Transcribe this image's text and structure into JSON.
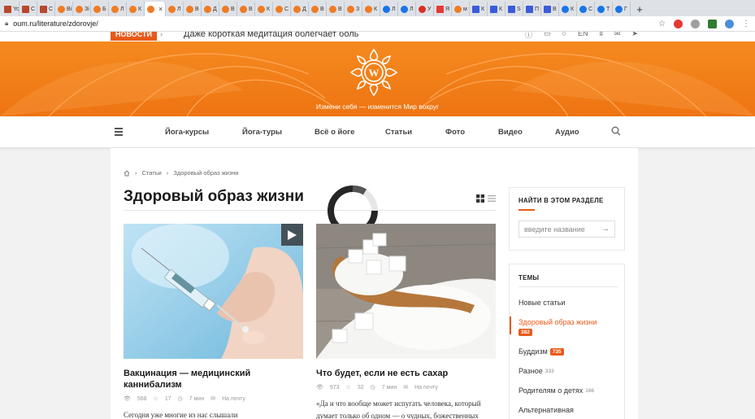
{
  "browser": {
    "tabs": [
      {
        "label": "Yo",
        "color": "#b8472b",
        "sq": true
      },
      {
        "label": "C",
        "color": "#b8472b",
        "sq": true
      },
      {
        "label": "C",
        "color": "#b8472b",
        "sq": true
      },
      {
        "label": "Bi",
        "color": "#f07b23"
      },
      {
        "label": "Зі",
        "color": "#f07b23"
      },
      {
        "label": "Б",
        "color": "#f07b23"
      },
      {
        "label": "Л",
        "color": "#f07b23"
      },
      {
        "label": "К",
        "color": "#f07b23"
      },
      {
        "label": "",
        "color": "#f07b23",
        "active": true
      },
      {
        "label": "Л",
        "color": "#f07b23"
      },
      {
        "label": "В",
        "color": "#f07b23"
      },
      {
        "label": "Д",
        "color": "#f07b23"
      },
      {
        "label": "В",
        "color": "#f07b23"
      },
      {
        "label": "В",
        "color": "#f07b23"
      },
      {
        "label": "К",
        "color": "#f07b23"
      },
      {
        "label": "С",
        "color": "#f07b23"
      },
      {
        "label": "Д",
        "color": "#f07b23"
      },
      {
        "label": "В",
        "color": "#f07b23"
      },
      {
        "label": "В",
        "color": "#f07b23"
      },
      {
        "label": "З",
        "color": "#f07b23"
      },
      {
        "label": "К",
        "color": "#f07b23"
      },
      {
        "label": "Л",
        "color": "#1a73e8"
      },
      {
        "label": "Л",
        "color": "#1a73e8"
      },
      {
        "label": "У",
        "color": "#d93025"
      },
      {
        "label": "Я",
        "color": "#e53935",
        "sq": true
      },
      {
        "label": "м",
        "color": "#f07b23"
      },
      {
        "label": "К",
        "color": "#3b5bdb",
        "sq": true
      },
      {
        "label": "К",
        "color": "#3b5bdb",
        "sq": true
      },
      {
        "label": "S",
        "color": "#3b5bdb",
        "sq": true
      },
      {
        "label": "П",
        "color": "#3b5bdb",
        "sq": true
      },
      {
        "label": "В",
        "color": "#3b5bdb",
        "sq": true
      },
      {
        "label": "К",
        "color": "#1a73e8"
      },
      {
        "label": "С",
        "color": "#1a73e8"
      },
      {
        "label": "Т",
        "color": "#1a73e8"
      },
      {
        "label": "Г",
        "color": "#1a73e8"
      }
    ],
    "tab_close": "×",
    "new_tab": "+",
    "url": "oum.ru/literature/zdorovje/"
  },
  "topnav": {
    "news_label": "НОВОСТИ",
    "news_text": "Даже короткая медитация облегчает боль",
    "lang": "EN"
  },
  "banner": {
    "tagline": "Измени себя — изменится Мир вокруг"
  },
  "nav": {
    "items": [
      "Йога-курсы",
      "Йога-туры",
      "Всё о йоге",
      "Статьи",
      "Фото",
      "Видео",
      "Аудио"
    ]
  },
  "breadcrumb": {
    "items": [
      "Статьи",
      "Здоровый образ жизни"
    ]
  },
  "page": {
    "title": "Здоровый образ жизни"
  },
  "articles": [
    {
      "title": "Вакцинация — медицинский каннибализм",
      "views": "568",
      "likes": "17",
      "time": "7 мин",
      "email": "На почту",
      "excerpt": "Сегодня уже многие из нас слышали",
      "has_video": true
    },
    {
      "title": "Что будет, если не есть сахар",
      "views": "973",
      "likes": "32",
      "time": "7 мин",
      "email": "На почту",
      "excerpt": "«Да и что вообще может испугать человека, который думает только об одном — о чудных, божественных",
      "has_video": false
    }
  ],
  "sidebar": {
    "search_title": "НАЙТИ В ЭТОМ РАЗДЕЛЕ",
    "search_placeholder": "введите название",
    "topics_title": "ТЕМЫ",
    "topics": [
      {
        "label": "Новые статьи",
        "count": "",
        "badge": false,
        "active": false
      },
      {
        "label": "Здоровый образ жизни",
        "count": "382",
        "badge": true,
        "active": true
      },
      {
        "label": "Буддизм",
        "count": "735",
        "badge": true,
        "active": false
      },
      {
        "label": "Разное",
        "count": "333",
        "badge": false,
        "active": false
      },
      {
        "label": "Родителям о детях",
        "count": "166",
        "badge": false,
        "active": false
      },
      {
        "label": "Альтернативная",
        "count": "",
        "badge": false,
        "active": false
      }
    ]
  },
  "colors": {
    "accent": "#e85a1a",
    "banner": "#f58a1f"
  }
}
